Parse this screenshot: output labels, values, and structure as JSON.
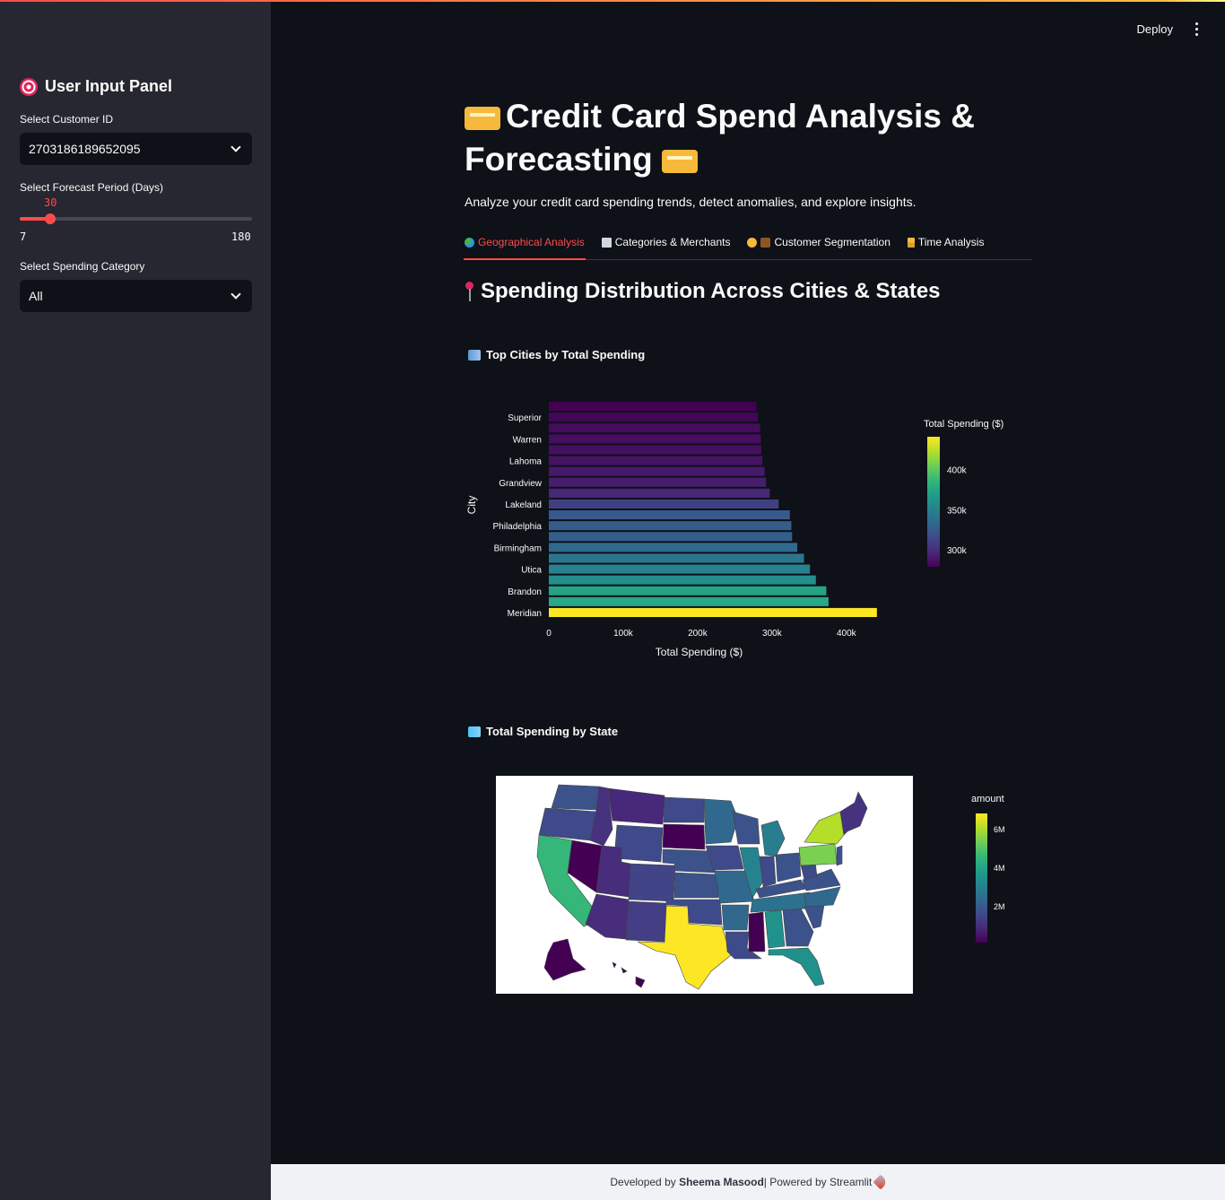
{
  "header": {
    "deploy_label": "Deploy",
    "menu_icon": "kebab-menu-icon"
  },
  "sidebar": {
    "title": "User Input Panel",
    "title_icon": "target-icon",
    "customer_label": "Select Customer ID",
    "customer_value": "2703186189652095",
    "forecast_label": "Select Forecast Period (Days)",
    "forecast_value": "30",
    "forecast_min": "7",
    "forecast_max": "180",
    "category_label": "Select Spending Category",
    "category_value": "All"
  },
  "main": {
    "title_line1": "Credit Card Spend Analysis &",
    "title_line2": "Forecasting",
    "subtitle": "Analyze your credit card spending trends, detect anomalies, and explore insights.",
    "tabs": [
      {
        "label": "Geographical Analysis",
        "icon": "globe-icon",
        "active": true
      },
      {
        "label": "Categories & Merchants",
        "icon": "receipt-icon",
        "active": false
      },
      {
        "label": "Customer Segmentation",
        "icon": "people-briefcase-icon",
        "active": false
      },
      {
        "label": "Time Analysis",
        "icon": "hourglass-icon",
        "active": false
      }
    ],
    "section_title": "Spending Distribution Across Cities & States",
    "chart1_title": "Top Cities by Total Spending",
    "chart2_title": "Total Spending by State"
  },
  "chart_data": [
    {
      "type": "bar",
      "orientation": "horizontal",
      "title": "",
      "xlabel": "Total Spending ($)",
      "ylabel": "City",
      "xlim": [
        0,
        440000
      ],
      "x_ticks": [
        "0",
        "100k",
        "200k",
        "300k",
        "400k"
      ],
      "colorbar_title": "Total Spending ($)",
      "colorbar_ticks": [
        "300k",
        "350k",
        "400k"
      ],
      "colorscale": "viridis",
      "categories": [
        "",
        "Superior",
        "",
        "Warren",
        "",
        "Lahoma",
        "",
        "Grandview",
        "",
        "Lakeland",
        "",
        "Philadelphia",
        "",
        "Birmingham",
        "",
        "Utica",
        "",
        "Brandon",
        "",
        "Meridian"
      ],
      "values": [
        279000,
        281000,
        284000,
        285000,
        285500,
        287000,
        290000,
        292000,
        297000,
        309000,
        324000,
        326000,
        327000,
        334000,
        343000,
        351000,
        359000,
        373000,
        376000,
        441000
      ]
    },
    {
      "type": "choropleth",
      "region": "USA states",
      "colorbar_title": "amount",
      "colorbar_ticks": [
        "2M",
        "4M",
        "6M"
      ],
      "colorscale": "viridis",
      "highlights": {
        "TX": "highest",
        "NY": "very high",
        "PA": "very high",
        "CA": "high",
        "FL": "medium-high"
      }
    }
  ],
  "footer": {
    "prefix": "Developed by ",
    "author": "Sheema Masood",
    "suffix": " | Powered by Streamlit",
    "icon": "rocket-icon"
  }
}
